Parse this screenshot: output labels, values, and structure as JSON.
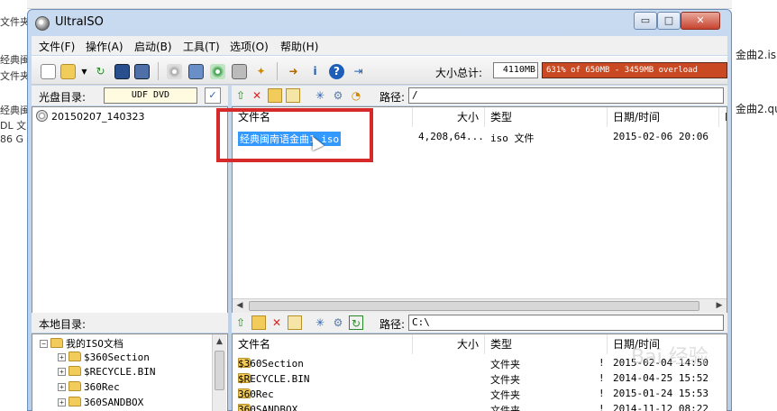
{
  "background": {
    "left_texts": [
      "文件夹",
      "经典闽",
      "文件夹",
      "经典闽",
      "DL 文",
      "86 G"
    ],
    "right_texts": [
      "金曲2.is",
      "金曲2.qu"
    ]
  },
  "window": {
    "title": "UltraISO",
    "controls": {
      "minimize": "▭",
      "maximize": "□",
      "close": "✕"
    }
  },
  "menu": [
    "文件(F)",
    "操作(A)",
    "启动(B)",
    "工具(T)",
    "选项(O)",
    "帮助(H)"
  ],
  "toolbar": {
    "icons": [
      "new-icon",
      "open-icon",
      "dropdown-icon",
      "reload-icon",
      "save-icon",
      "save-as-icon",
      "burn-icon",
      "mount-icon",
      "compress-icon",
      "virtual-drive-icon",
      "boot-icon",
      "extract-icon",
      "info-icon",
      "help-icon",
      "exit-icon"
    ],
    "total_size_label": "大小总计:",
    "total_size_value": "4110MB",
    "capacity_text": "631% of 650MB - 3459MB overload",
    "capacity_color": "#c94a22"
  },
  "disc": {
    "label": "光盘目录:",
    "volume_label": "UDF DVD",
    "tree_root": "20150207_140323"
  },
  "iso_pane": {
    "path_label": "路径:",
    "path": "/",
    "columns": [
      "文件名",
      "大小",
      "类型",
      "日期/时间",
      "L"
    ],
    "files": [
      {
        "name": "经典闽南语金曲1.iso",
        "size": "4,208,64...",
        "type": "iso 文件",
        "date": "2015-02-06 20:06",
        "selected": true
      }
    ]
  },
  "local": {
    "label": "本地目录:",
    "path_label": "路径:",
    "path": "C:\\",
    "tree": [
      {
        "name": "我的ISO文档",
        "level": 0,
        "expander": "−"
      },
      {
        "name": "$360Section",
        "level": 1,
        "expander": "+"
      },
      {
        "name": "$RECYCLE.BIN",
        "level": 1,
        "expander": "+"
      },
      {
        "name": "360Rec",
        "level": 1,
        "expander": "+"
      },
      {
        "name": "360SANDBOX",
        "level": 1,
        "expander": "+"
      }
    ],
    "columns": [
      "文件名",
      "大小",
      "类型",
      "日期/时间"
    ],
    "files": [
      {
        "name": "$360Section",
        "type": "文件夹",
        "flag": "!",
        "date": "2015-02-04 14:50"
      },
      {
        "name": "$RECYCLE.BIN",
        "type": "文件夹",
        "flag": "!",
        "date": "2014-04-25 15:52"
      },
      {
        "name": "360Rec",
        "type": "文件夹",
        "flag": "!",
        "date": "2015-01-24 15:53"
      },
      {
        "name": "360SANDBOX",
        "type": "文件夹",
        "flag": "!",
        "date": "2014-11-12 08:22"
      }
    ]
  },
  "watermark": "Bai 经验"
}
